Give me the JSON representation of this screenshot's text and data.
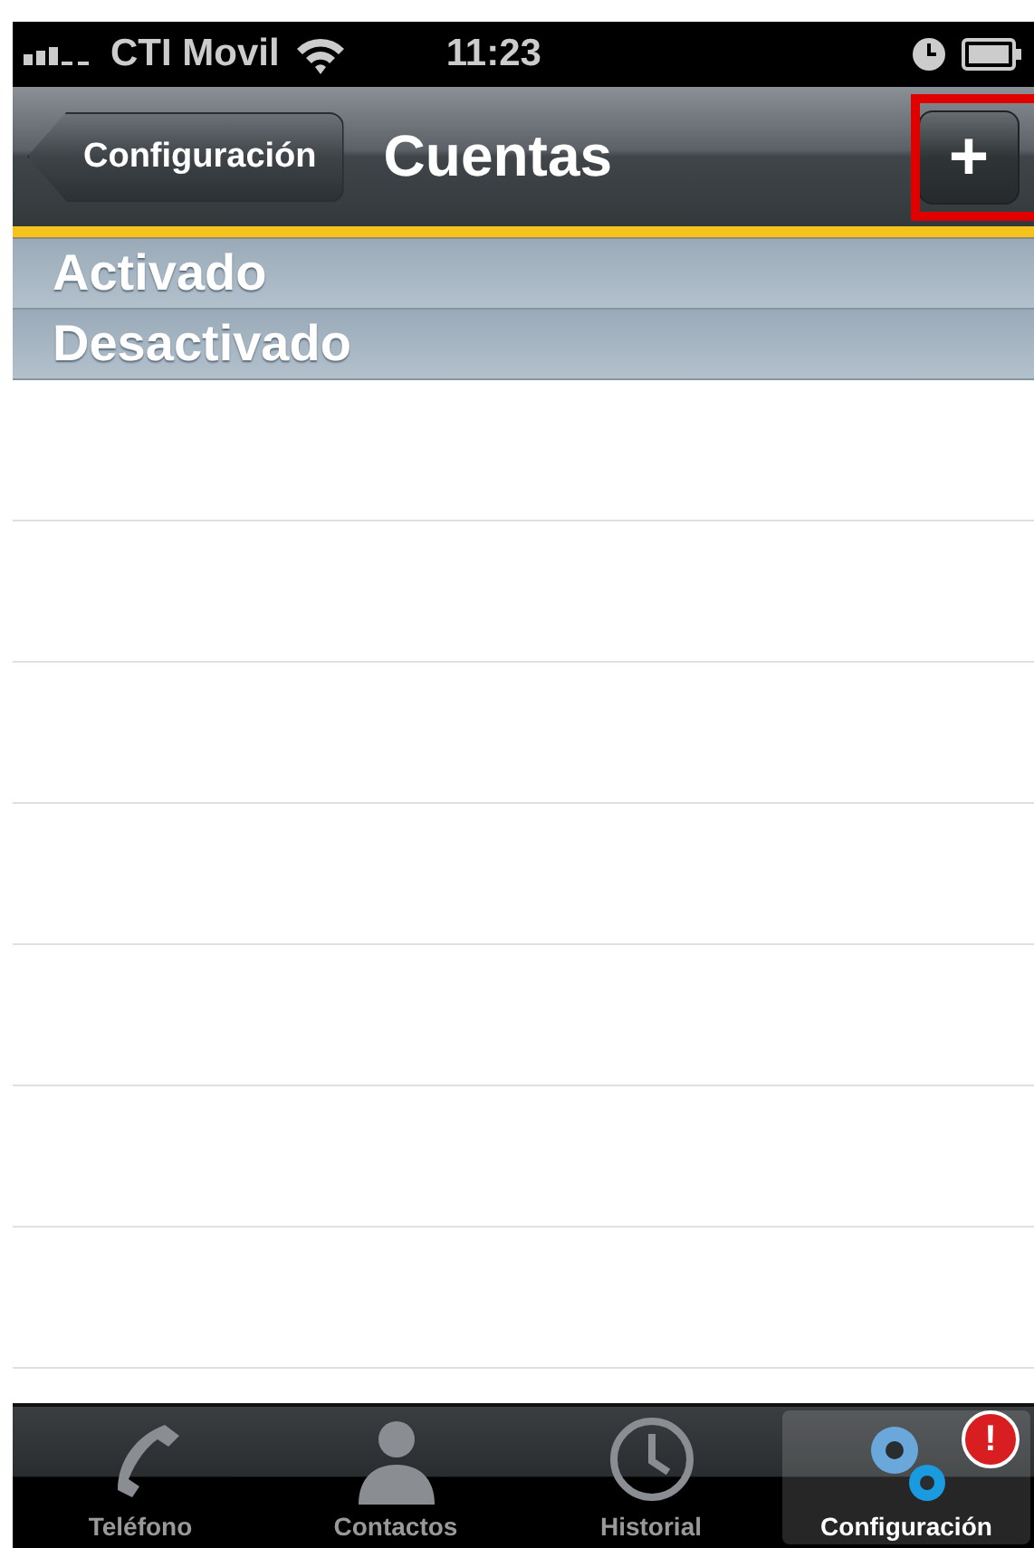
{
  "status_bar": {
    "carrier": "CTI Movil",
    "time": "11:23"
  },
  "nav_bar": {
    "back_button": "Configuración",
    "title": "Cuentas",
    "add_button": {
      "label": "+",
      "highlighted": true
    }
  },
  "sections": [
    {
      "title": "Activado"
    },
    {
      "title": "Desactivado"
    }
  ],
  "tab_bar": [
    {
      "kind": "phone",
      "label": "Teléfono",
      "selected": false
    },
    {
      "kind": "contacts",
      "label": "Contactos",
      "selected": false
    },
    {
      "kind": "history",
      "label": "Historial",
      "selected": false
    },
    {
      "kind": "settings",
      "label": "Configuración",
      "selected": true,
      "badge": "!"
    }
  ]
}
